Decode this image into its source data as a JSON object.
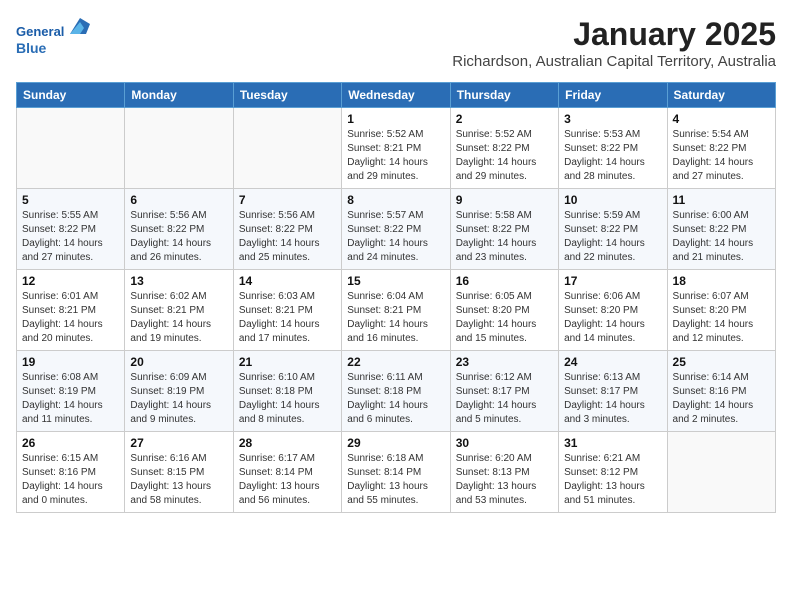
{
  "header": {
    "logo_line1": "General",
    "logo_line2": "Blue",
    "month_title": "January 2025",
    "subtitle": "Richardson, Australian Capital Territory, Australia"
  },
  "days_of_week": [
    "Sunday",
    "Monday",
    "Tuesday",
    "Wednesday",
    "Thursday",
    "Friday",
    "Saturday"
  ],
  "weeks": [
    [
      {
        "day": "",
        "info": ""
      },
      {
        "day": "",
        "info": ""
      },
      {
        "day": "",
        "info": ""
      },
      {
        "day": "1",
        "info": "Sunrise: 5:52 AM\nSunset: 8:21 PM\nDaylight: 14 hours\nand 29 minutes."
      },
      {
        "day": "2",
        "info": "Sunrise: 5:52 AM\nSunset: 8:22 PM\nDaylight: 14 hours\nand 29 minutes."
      },
      {
        "day": "3",
        "info": "Sunrise: 5:53 AM\nSunset: 8:22 PM\nDaylight: 14 hours\nand 28 minutes."
      },
      {
        "day": "4",
        "info": "Sunrise: 5:54 AM\nSunset: 8:22 PM\nDaylight: 14 hours\nand 27 minutes."
      }
    ],
    [
      {
        "day": "5",
        "info": "Sunrise: 5:55 AM\nSunset: 8:22 PM\nDaylight: 14 hours\nand 27 minutes."
      },
      {
        "day": "6",
        "info": "Sunrise: 5:56 AM\nSunset: 8:22 PM\nDaylight: 14 hours\nand 26 minutes."
      },
      {
        "day": "7",
        "info": "Sunrise: 5:56 AM\nSunset: 8:22 PM\nDaylight: 14 hours\nand 25 minutes."
      },
      {
        "day": "8",
        "info": "Sunrise: 5:57 AM\nSunset: 8:22 PM\nDaylight: 14 hours\nand 24 minutes."
      },
      {
        "day": "9",
        "info": "Sunrise: 5:58 AM\nSunset: 8:22 PM\nDaylight: 14 hours\nand 23 minutes."
      },
      {
        "day": "10",
        "info": "Sunrise: 5:59 AM\nSunset: 8:22 PM\nDaylight: 14 hours\nand 22 minutes."
      },
      {
        "day": "11",
        "info": "Sunrise: 6:00 AM\nSunset: 8:22 PM\nDaylight: 14 hours\nand 21 minutes."
      }
    ],
    [
      {
        "day": "12",
        "info": "Sunrise: 6:01 AM\nSunset: 8:21 PM\nDaylight: 14 hours\nand 20 minutes."
      },
      {
        "day": "13",
        "info": "Sunrise: 6:02 AM\nSunset: 8:21 PM\nDaylight: 14 hours\nand 19 minutes."
      },
      {
        "day": "14",
        "info": "Sunrise: 6:03 AM\nSunset: 8:21 PM\nDaylight: 14 hours\nand 17 minutes."
      },
      {
        "day": "15",
        "info": "Sunrise: 6:04 AM\nSunset: 8:21 PM\nDaylight: 14 hours\nand 16 minutes."
      },
      {
        "day": "16",
        "info": "Sunrise: 6:05 AM\nSunset: 8:20 PM\nDaylight: 14 hours\nand 15 minutes."
      },
      {
        "day": "17",
        "info": "Sunrise: 6:06 AM\nSunset: 8:20 PM\nDaylight: 14 hours\nand 14 minutes."
      },
      {
        "day": "18",
        "info": "Sunrise: 6:07 AM\nSunset: 8:20 PM\nDaylight: 14 hours\nand 12 minutes."
      }
    ],
    [
      {
        "day": "19",
        "info": "Sunrise: 6:08 AM\nSunset: 8:19 PM\nDaylight: 14 hours\nand 11 minutes."
      },
      {
        "day": "20",
        "info": "Sunrise: 6:09 AM\nSunset: 8:19 PM\nDaylight: 14 hours\nand 9 minutes."
      },
      {
        "day": "21",
        "info": "Sunrise: 6:10 AM\nSunset: 8:18 PM\nDaylight: 14 hours\nand 8 minutes."
      },
      {
        "day": "22",
        "info": "Sunrise: 6:11 AM\nSunset: 8:18 PM\nDaylight: 14 hours\nand 6 minutes."
      },
      {
        "day": "23",
        "info": "Sunrise: 6:12 AM\nSunset: 8:17 PM\nDaylight: 14 hours\nand 5 minutes."
      },
      {
        "day": "24",
        "info": "Sunrise: 6:13 AM\nSunset: 8:17 PM\nDaylight: 14 hours\nand 3 minutes."
      },
      {
        "day": "25",
        "info": "Sunrise: 6:14 AM\nSunset: 8:16 PM\nDaylight: 14 hours\nand 2 minutes."
      }
    ],
    [
      {
        "day": "26",
        "info": "Sunrise: 6:15 AM\nSunset: 8:16 PM\nDaylight: 14 hours\nand 0 minutes."
      },
      {
        "day": "27",
        "info": "Sunrise: 6:16 AM\nSunset: 8:15 PM\nDaylight: 13 hours\nand 58 minutes."
      },
      {
        "day": "28",
        "info": "Sunrise: 6:17 AM\nSunset: 8:14 PM\nDaylight: 13 hours\nand 56 minutes."
      },
      {
        "day": "29",
        "info": "Sunrise: 6:18 AM\nSunset: 8:14 PM\nDaylight: 13 hours\nand 55 minutes."
      },
      {
        "day": "30",
        "info": "Sunrise: 6:20 AM\nSunset: 8:13 PM\nDaylight: 13 hours\nand 53 minutes."
      },
      {
        "day": "31",
        "info": "Sunrise: 6:21 AM\nSunset: 8:12 PM\nDaylight: 13 hours\nand 51 minutes."
      },
      {
        "day": "",
        "info": ""
      }
    ]
  ]
}
